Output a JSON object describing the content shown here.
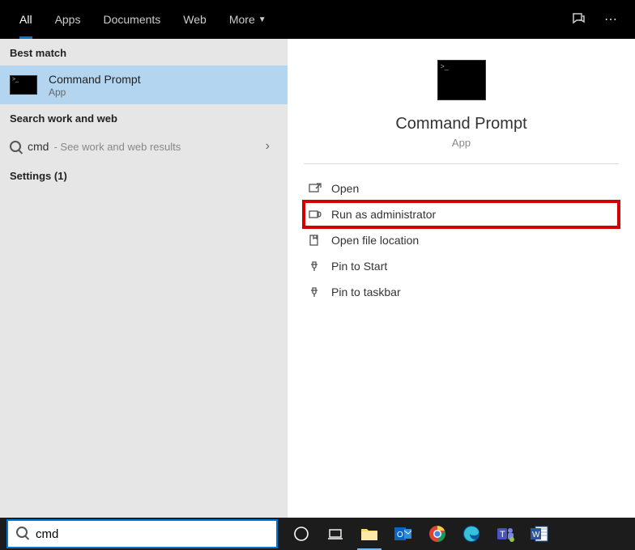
{
  "tabs": {
    "all": "All",
    "apps": "Apps",
    "documents": "Documents",
    "web": "Web",
    "more": "More"
  },
  "sections": {
    "best_match": "Best match",
    "search_work_web": "Search work and web",
    "settings": "Settings (1)"
  },
  "best_match_item": {
    "title": "Command Prompt",
    "subtitle": "App"
  },
  "web_result": {
    "query": "cmd",
    "subtitle": "- See work and web results"
  },
  "detail": {
    "title": "Command Prompt",
    "subtitle": "App"
  },
  "actions": {
    "open": "Open",
    "run_admin": "Run as administrator",
    "open_location": "Open file location",
    "pin_start": "Pin to Start",
    "pin_taskbar": "Pin to taskbar"
  },
  "search": {
    "value": "cmd"
  }
}
